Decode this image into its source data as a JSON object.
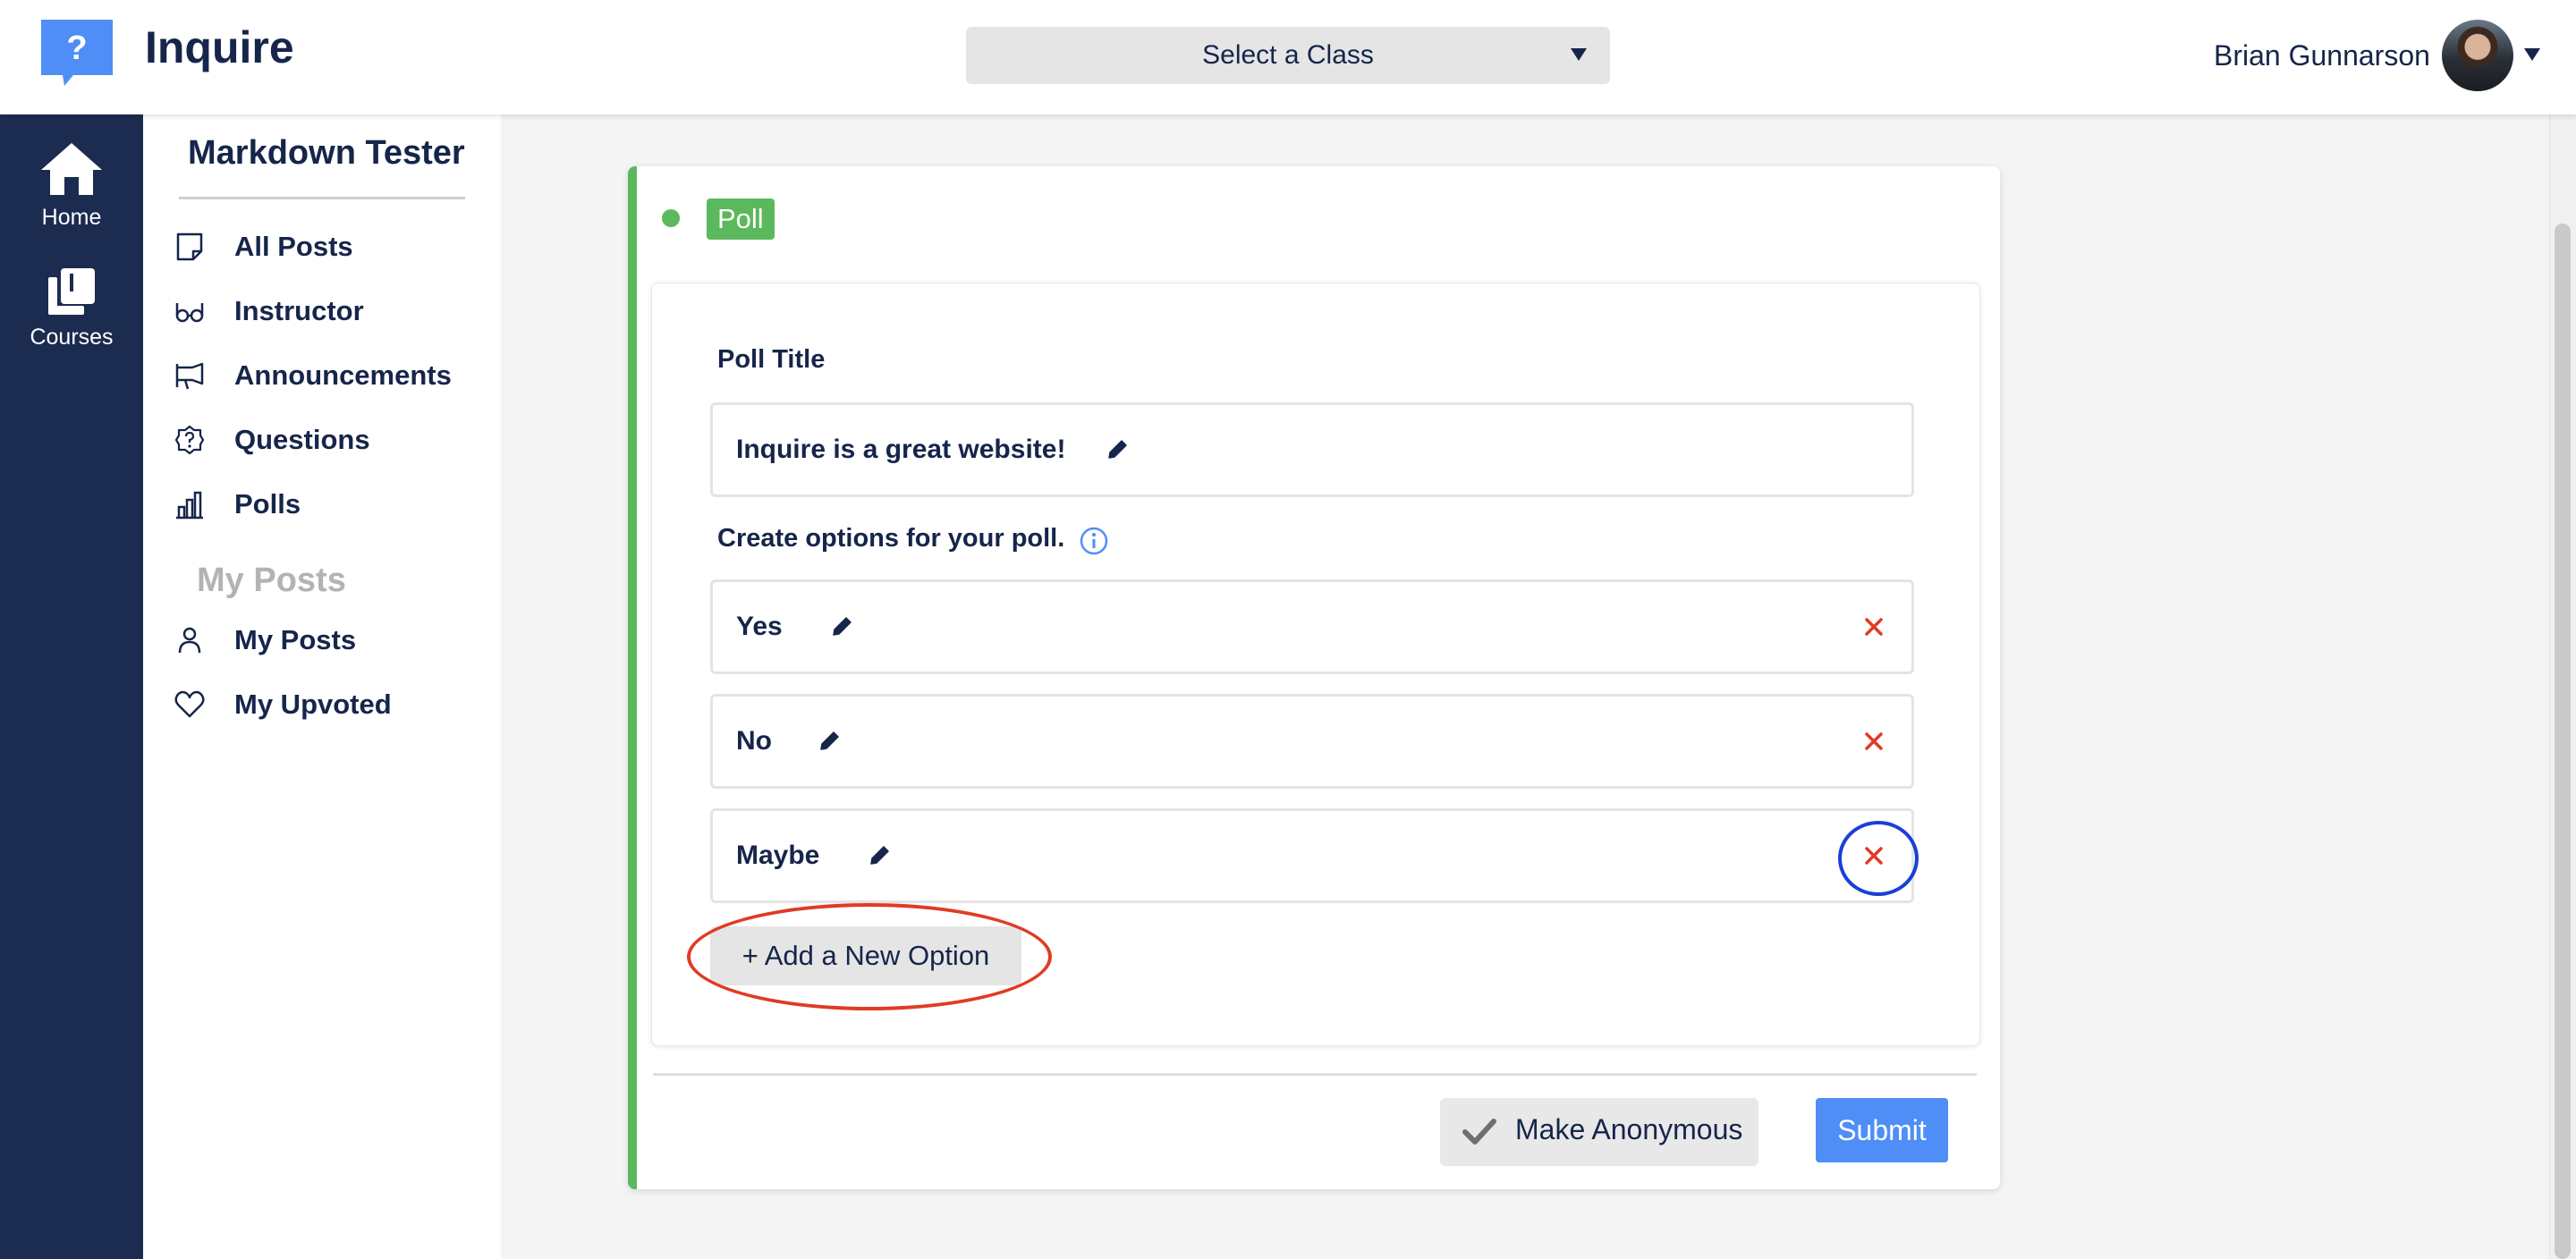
{
  "app": {
    "name": "Inquire",
    "logo_glyph": "?"
  },
  "header": {
    "class_select": "Select a Class",
    "user_name": "Brian Gunnarson"
  },
  "rail": {
    "items": [
      {
        "label": "Home",
        "icon": "home-icon"
      },
      {
        "label": "Courses",
        "icon": "courses-icon"
      }
    ]
  },
  "sidebar": {
    "course_title": "Markdown Tester",
    "items": [
      {
        "label": "All Posts",
        "icon": "note-icon"
      },
      {
        "label": "Instructor",
        "icon": "glasses-icon"
      },
      {
        "label": "Announcements",
        "icon": "megaphone-icon"
      },
      {
        "label": "Questions",
        "icon": "question-badge-icon"
      },
      {
        "label": "Polls",
        "icon": "bar-chart-icon"
      }
    ],
    "my_posts_heading": "My Posts",
    "my_items": [
      {
        "label": "My Posts",
        "icon": "user-icon"
      },
      {
        "label": "My Upvoted",
        "icon": "heart-icon"
      }
    ]
  },
  "poll": {
    "tag": "Poll",
    "title_label": "Poll Title",
    "title_value": "Inquire is a great website!",
    "options_label": "Create options for your poll.",
    "options": [
      "Yes",
      "No",
      "Maybe"
    ],
    "add_option_label": "+ Add a New Option",
    "anonymous_label": "Make Anonymous",
    "submit_label": "Submit"
  },
  "colors": {
    "navy": "#1c2b50",
    "accent_green": "#5cb85c",
    "submit_blue": "#4f8ef7",
    "delete_red": "#e03b24",
    "annotation_blue": "#1a3fd6"
  }
}
